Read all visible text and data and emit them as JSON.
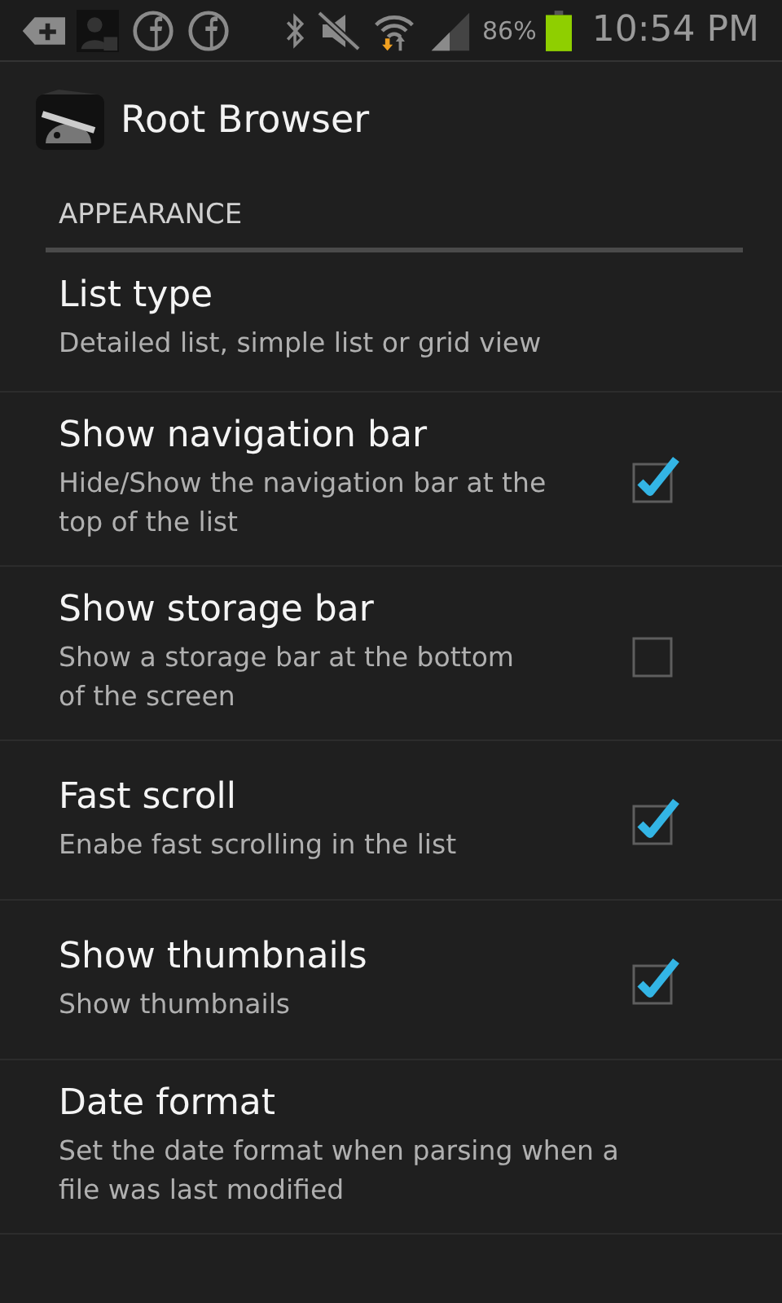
{
  "status_bar": {
    "battery_percent": "86%",
    "time": "10:54 PM"
  },
  "app_bar": {
    "title": "Root Browser"
  },
  "section": {
    "title": "APPEARANCE"
  },
  "items": [
    {
      "kind": "plain",
      "title": "List type",
      "summary": "Detailed list, simple list or grid view"
    },
    {
      "kind": "checkbox",
      "title": "Show navigation bar",
      "summary": "Hide/Show the navigation bar at the top of the list",
      "checked": true
    },
    {
      "kind": "checkbox",
      "title": "Show storage bar",
      "summary": "Show a storage bar at the bottom of the screen",
      "checked": false
    },
    {
      "kind": "checkbox",
      "title": "Fast scroll",
      "summary": "Enabe fast scrolling in the list",
      "checked": true
    },
    {
      "kind": "checkbox",
      "title": "Show thumbnails",
      "summary": "Show thumbnails",
      "checked": true
    },
    {
      "kind": "plain",
      "title": "Date format",
      "summary": "Set the date format when parsing when a file was last modified"
    }
  ]
}
